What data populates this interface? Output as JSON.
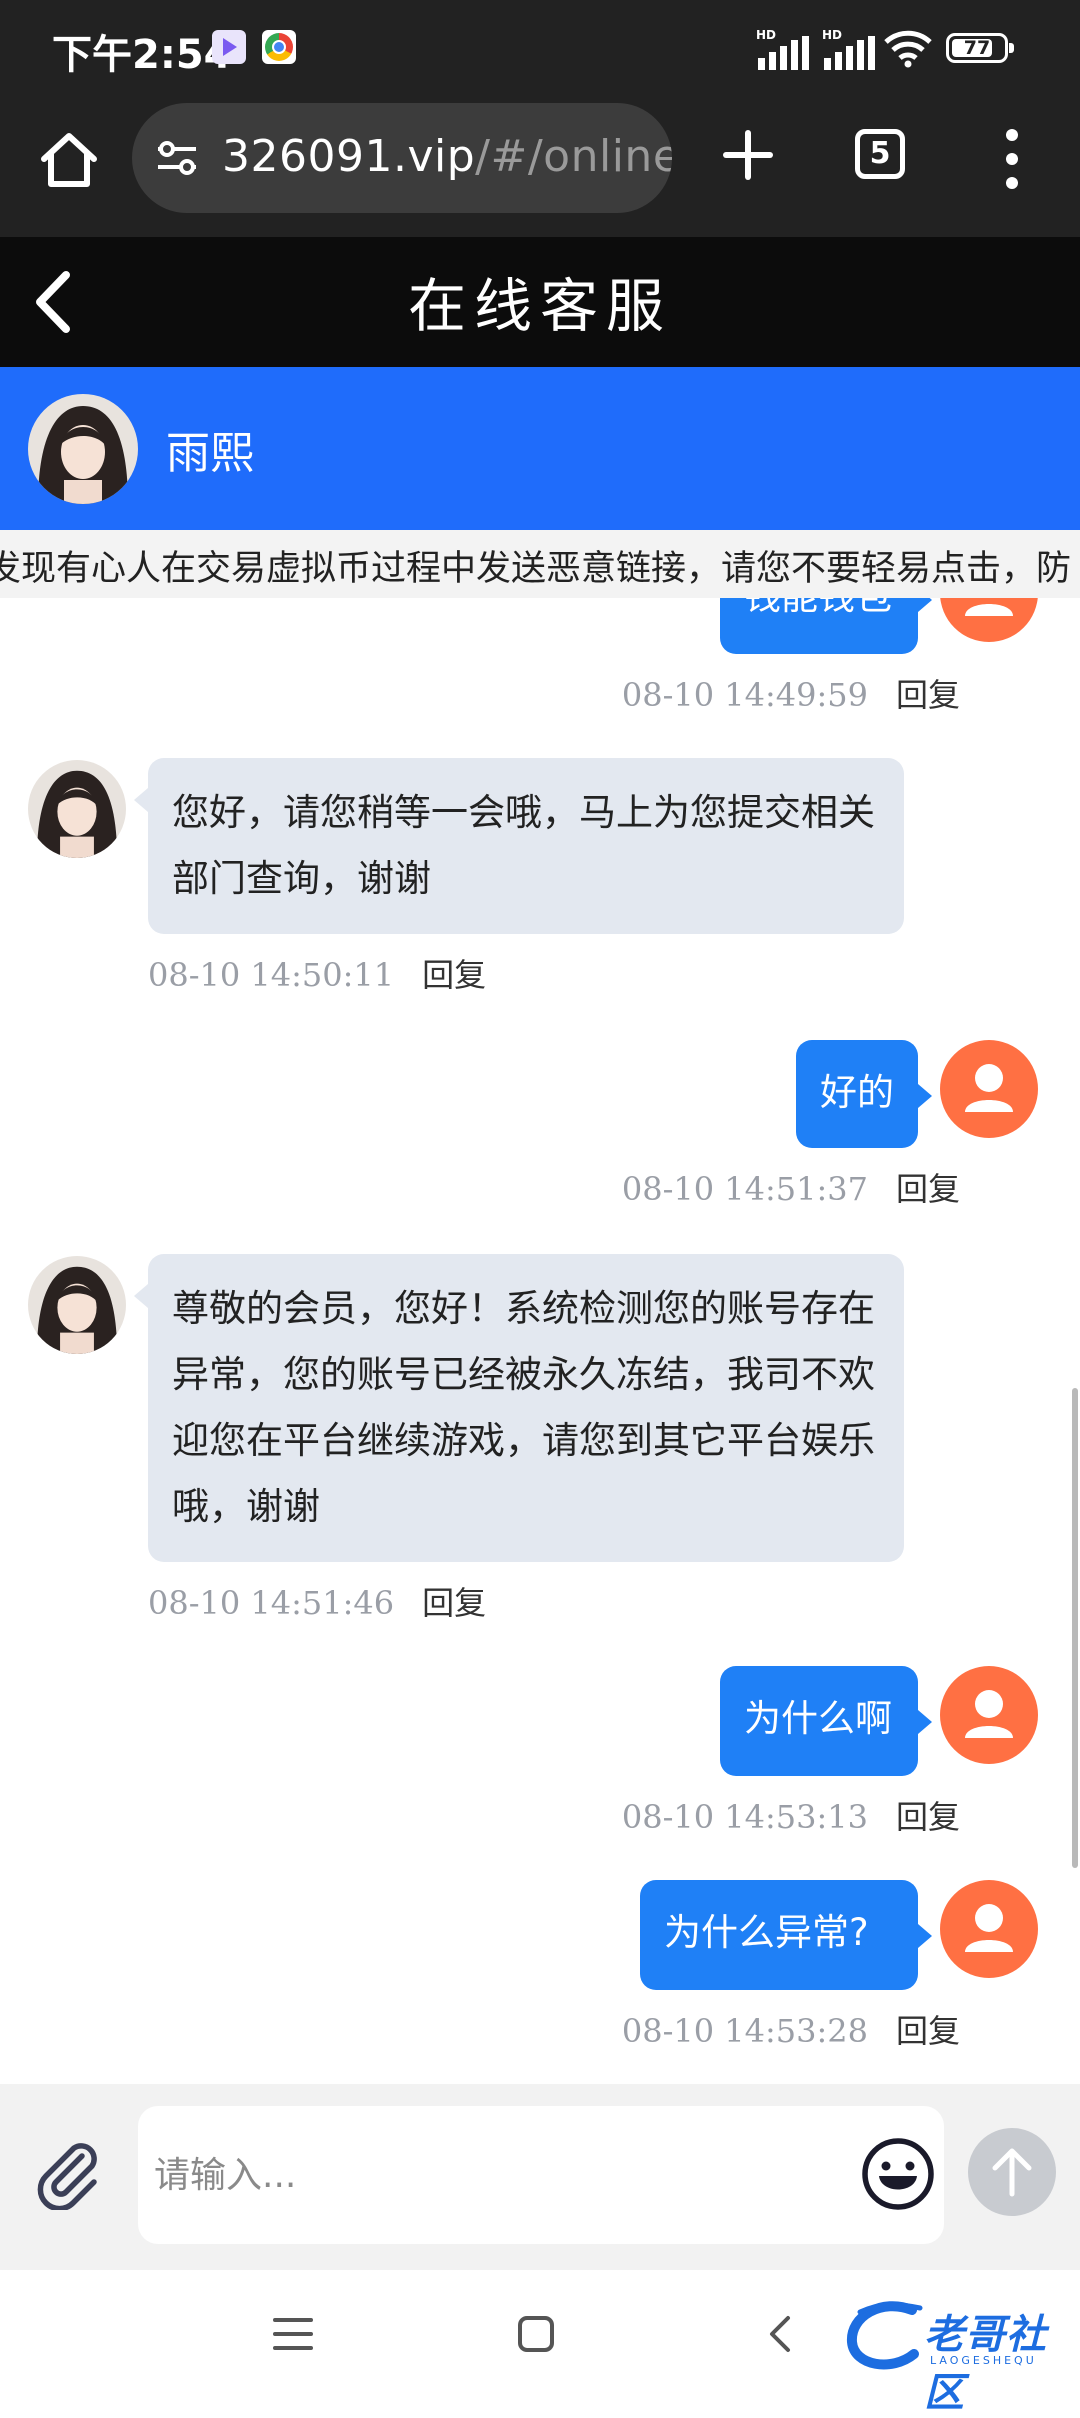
{
  "status_bar": {
    "time": "下午2:54",
    "signal_label": "HD",
    "battery_level": "77"
  },
  "browser": {
    "url_host": "326091.vip",
    "url_path": "/#/onlineC",
    "tab_count": "5"
  },
  "page": {
    "title": "在线客服"
  },
  "agent": {
    "name": "雨熙"
  },
  "notice": {
    "text": "发现有心人在交易虚拟币过程中发送恶意链接，请您不要轻易点击，防"
  },
  "messages": [
    {
      "side": "out",
      "text": "钱能钱包",
      "time": "08-10 14:49:59",
      "reply": "回复"
    },
    {
      "side": "in",
      "text": "您好，请您稍等一会哦，马上为您提交相关部门查询，谢谢",
      "time": "08-10 14:50:11",
      "reply": "回复"
    },
    {
      "side": "out",
      "text": "好的",
      "time": "08-10 14:51:37",
      "reply": "回复"
    },
    {
      "side": "in",
      "text": "尊敬的会员，您好！系统检测您的账号存在异常，您的账号已经被永久冻结，我司不欢迎您在平台继续游戏，请您到其它平台娱乐哦，谢谢",
      "time": "08-10 14:51:46",
      "reply": "回复"
    },
    {
      "side": "out",
      "text": "为什么啊",
      "time": "08-10 14:53:13",
      "reply": "回复"
    },
    {
      "side": "out",
      "text": "为什么异常?",
      "time": "08-10 14:53:28",
      "reply": "回复"
    }
  ],
  "input": {
    "placeholder": "请输入..."
  },
  "watermark": {
    "text": "老哥社区",
    "sub": "LAOGESHEQU"
  },
  "colors": {
    "agent_bar": "#1f6cfb",
    "user_bubble": "#1f80f6",
    "agent_bubble": "#e3e8f0",
    "user_avatar": "#ff7043",
    "header": "#0c0c0c"
  }
}
